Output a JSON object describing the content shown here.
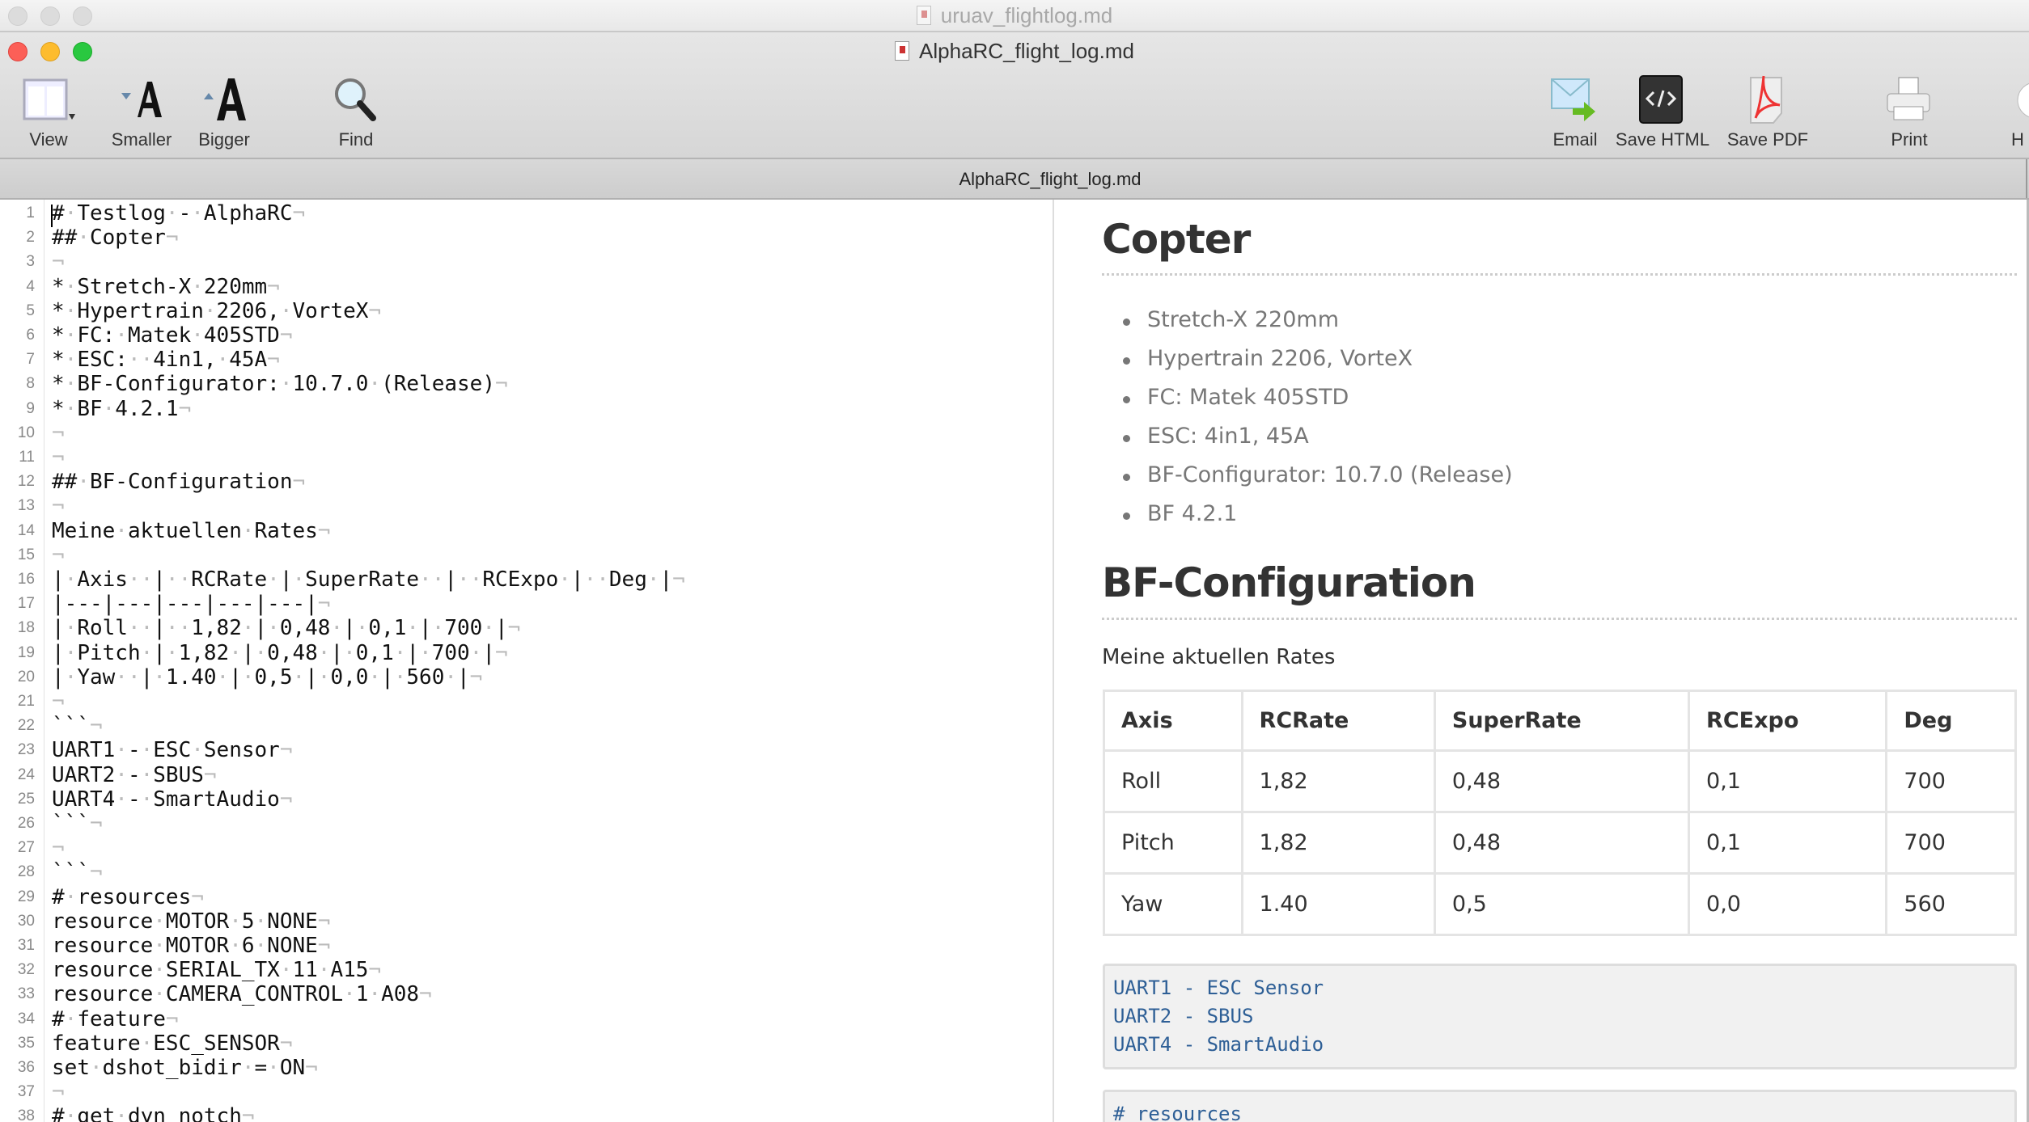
{
  "back_window": {
    "title": "uruav_flightlog.md"
  },
  "window": {
    "title": "AlphaRC_flight_log.md",
    "tab": "AlphaRC_flight_log.md"
  },
  "toolbar": {
    "view": "View",
    "smaller": "Smaller",
    "bigger": "Bigger",
    "find": "Find",
    "email": "Email",
    "save_html": "Save HTML",
    "save_pdf": "Save PDF",
    "print": "Print",
    "help": "H"
  },
  "editor": {
    "lines": [
      "# Testlog - AlphaRC",
      "## Copter",
      "",
      "* Stretch-X 220mm",
      "* Hypertrain 2206, VorteX",
      "* FC: Matek 405STD",
      "* ESC:  4in1, 45A",
      "* BF-Configurator: 10.7.0 (Release)",
      "* BF 4.2.1",
      "",
      "",
      "## BF-Configuration",
      "",
      "Meine aktuellen Rates",
      "",
      "| Axis  |  RCRate | SuperRate  |  RCExpo |  Deg |",
      "|---|---|---|---|---|",
      "| Roll  |  1,82 | 0,48 | 0,1 | 700 |",
      "| Pitch | 1,82 | 0,48 | 0,1 | 700 |",
      "| Yaw  | 1.40 | 0,5 | 0,0 | 560 |",
      "",
      "```",
      "UART1 - ESC Sensor",
      "UART2 - SBUS",
      "UART4 - SmartAudio",
      "```",
      "",
      "```",
      "# resources",
      "resource MOTOR 5 NONE",
      "resource MOTOR 6 NONE",
      "resource SERIAL_TX 11 A15",
      "resource CAMERA_CONTROL 1 A08",
      "# feature",
      "feature ESC_SENSOR",
      "set dshot_bidir = ON",
      "",
      "# get dyn_notch"
    ]
  },
  "preview": {
    "h_copter": "Copter",
    "copter_items": [
      "Stretch-X 220mm",
      "Hypertrain 2206, VorteX",
      "FC: Matek 405STD",
      "ESC: 4in1, 45A",
      "BF-Configurator: 10.7.0 (Release)",
      "BF 4.2.1"
    ],
    "h_bf": "BF-Configuration",
    "rates_intro": "Meine aktuellen Rates",
    "table": {
      "headers": [
        "Axis",
        "RCRate",
        "SuperRate",
        "RCExpo",
        "Deg"
      ],
      "rows": [
        [
          "Roll",
          "1,82",
          "0,48",
          "0,1",
          "700"
        ],
        [
          "Pitch",
          "1,82",
          "0,48",
          "0,1",
          "700"
        ],
        [
          "Yaw",
          "1.40",
          "0,5",
          "0,0",
          "560"
        ]
      ]
    },
    "code1": [
      "UART1 - ESC Sensor",
      "UART2 - SBUS",
      "UART4 - SmartAudio"
    ],
    "code2": [
      "# resources"
    ]
  }
}
